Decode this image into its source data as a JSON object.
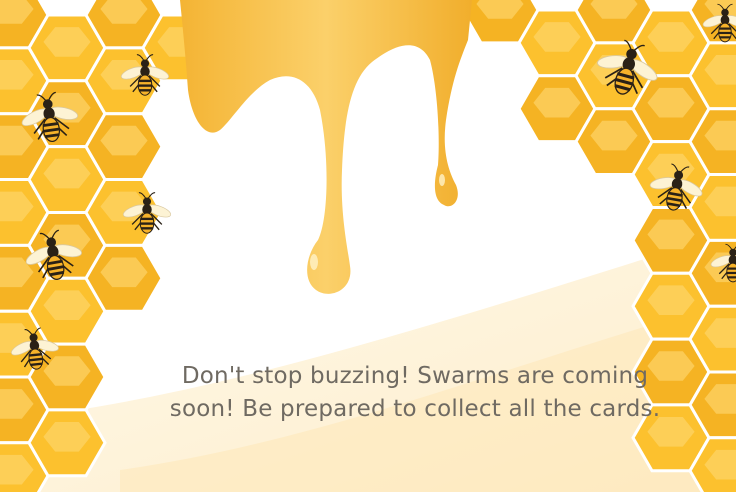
{
  "screen": {
    "message_line1": "Don't stop buzzing! Swarms are coming",
    "message_line2": "soon! Be prepared to collect all the cards."
  },
  "theme": {
    "honeycomb_fill": "#fcc12e",
    "honeycomb_light": "#fdd46a",
    "honeycomb_edge": "#f5b323",
    "honey_drip": "#f8c03e",
    "bee_stripe": "#2a2116",
    "bee_body": "#f6b22a",
    "bee_wing": "#fdf3d4",
    "text_color": "#6f6a62"
  }
}
